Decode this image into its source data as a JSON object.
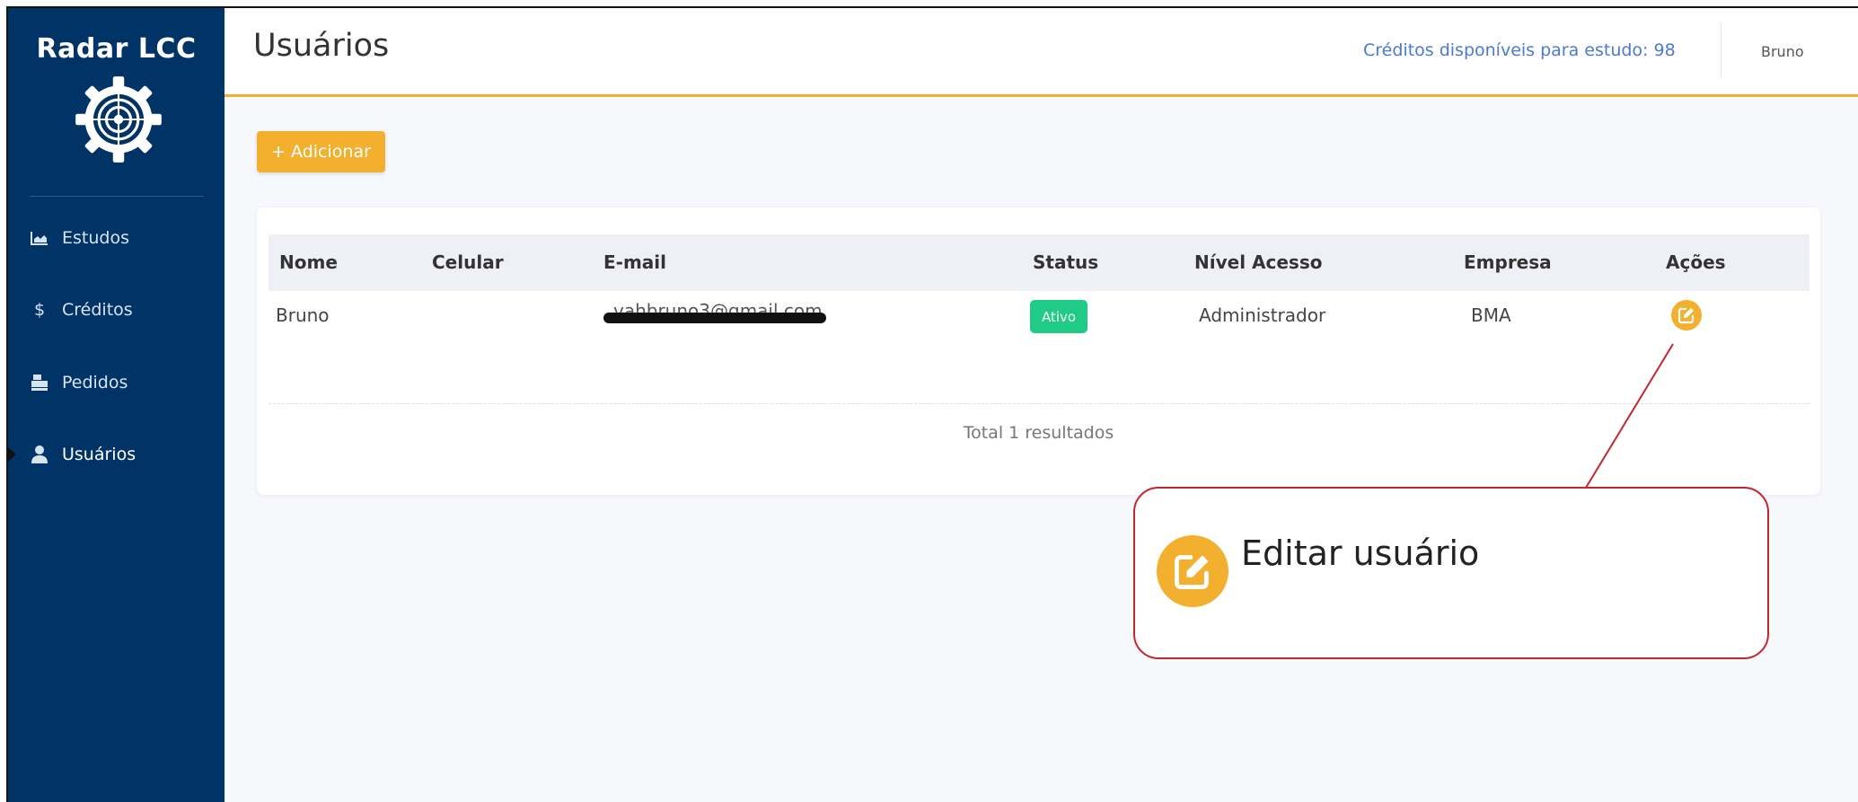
{
  "app": {
    "brand": "Radar LCC",
    "logo_icon": "target-gear-icon"
  },
  "sidebar": {
    "items": [
      {
        "label": "Estudos",
        "icon": "chart-icon"
      },
      {
        "label": "Créditos",
        "icon": "dollar-icon",
        "glyph": "$"
      },
      {
        "label": "Pedidos",
        "icon": "cash-register-icon"
      },
      {
        "label": "Usuários",
        "icon": "user-icon"
      }
    ]
  },
  "header": {
    "title": "Usuários",
    "credits": "Créditos disponíveis para estudo: 98",
    "user": "Bruno"
  },
  "toolbar": {
    "add_label": "+ Adicionar"
  },
  "table": {
    "columns": [
      "Nome",
      "Celular",
      "E-mail",
      "Status",
      "Nível Acesso",
      "Empresa",
      "Ações"
    ],
    "rows": [
      {
        "nome": "Bruno",
        "celular": "",
        "email": "vahbruno3@gmail.com",
        "status": "Ativo",
        "nivel": "Administrador",
        "empresa": "BMA"
      }
    ],
    "total": "Total 1 resultados"
  },
  "annotation": {
    "text": "Editar usuário",
    "icon": "edit-icon"
  },
  "colors": {
    "sidebar": "#003366",
    "accent": "#f3b02f",
    "status_active": "#1fcb87",
    "callout_border": "#c1272d",
    "credits_text": "#4a7bd0"
  }
}
